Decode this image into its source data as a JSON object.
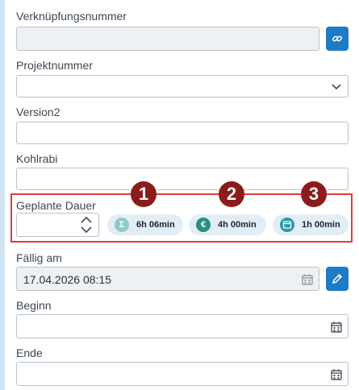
{
  "fields": {
    "link_number": {
      "label": "Verknüpfungsnummer",
      "value": ""
    },
    "project_number": {
      "label": "Projektnummer",
      "value": ""
    },
    "version2": {
      "label": "Version2",
      "value": ""
    },
    "kohlrabi": {
      "label": "Kohlrabi",
      "value": ""
    },
    "planned_duration": {
      "label": "Geplante Dauer",
      "value": ""
    },
    "due_date": {
      "label": "Fällig am",
      "value": "17.04.2026 08:15"
    },
    "start": {
      "label": "Beginn",
      "value": ""
    },
    "end": {
      "label": "Ende",
      "value": ""
    }
  },
  "duration_pills": [
    {
      "text": "6h 06min",
      "icon": "sigma-icon",
      "color": "#8fc9c9"
    },
    {
      "text": "4h 00min",
      "icon": "euro-icon",
      "color": "#2a8f7f"
    },
    {
      "text": "1h 00min",
      "icon": "calendar-box-icon",
      "color": "#2a9aa8"
    }
  ],
  "markers": [
    "1",
    "2",
    "3"
  ],
  "colors": {
    "accent_button": "#1e7bc4",
    "highlight_border": "#e03a3a",
    "marker_fill": "#8c1b1b",
    "pill_background": "#e3edf5"
  }
}
